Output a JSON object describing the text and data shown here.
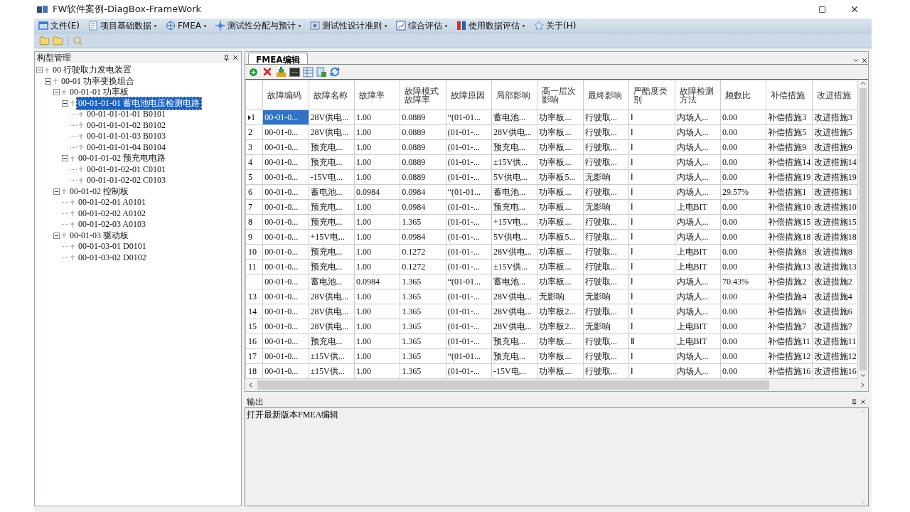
{
  "window": {
    "title": "FW软件案例-DiagBox-FrameWork"
  },
  "menu": [
    {
      "label": "文件(E)",
      "dropdown": false
    },
    {
      "label": "项目基础数据",
      "dropdown": true
    },
    {
      "label": "FMEA",
      "dropdown": true
    },
    {
      "label": "测试性分配与预计",
      "dropdown": true
    },
    {
      "label": "测试性设计准则",
      "dropdown": true
    },
    {
      "label": "综合评估",
      "dropdown": true
    },
    {
      "label": "使用数据评估",
      "dropdown": true
    },
    {
      "label": "关于(H)",
      "dropdown": false
    }
  ],
  "tree_panel": {
    "title": "构型管理",
    "nodes": [
      {
        "label": "00 行驶取力发电装置",
        "selected": false,
        "expanded": true,
        "children": [
          {
            "label": "00-01 功率变换组合",
            "selected": false,
            "expanded": true,
            "children": [
              {
                "label": "00-01-01 功率板",
                "selected": false,
                "expanded": true,
                "children": [
                  {
                    "label": "00-01-01-01 蓄电池电压检测电路",
                    "selected": true,
                    "expanded": true,
                    "children": [
                      {
                        "label": "00-01-01-01-01 B0101",
                        "selected": false
                      },
                      {
                        "label": "00-01-01-01-02 B0102",
                        "selected": false
                      },
                      {
                        "label": "00-01-01-01-03 B0103",
                        "selected": false
                      },
                      {
                        "label": "00-01-01-01-04 B0104",
                        "selected": false
                      }
                    ]
                  },
                  {
                    "label": "00-01-01-02 预充电电路",
                    "selected": false,
                    "expanded": true,
                    "children": [
                      {
                        "label": "00-01-01-02-01 C0101",
                        "selected": false
                      },
                      {
                        "label": "00-01-01-02-02 C0103",
                        "selected": false
                      }
                    ]
                  }
                ]
              },
              {
                "label": "00-01-02 控制板",
                "selected": false,
                "expanded": true,
                "children": [
                  {
                    "label": "00-01-02-01 A0101",
                    "selected": false
                  },
                  {
                    "label": "00-01-02-02 A0102",
                    "selected": false
                  },
                  {
                    "label": "00-01-02-03 A0103",
                    "selected": false
                  }
                ]
              },
              {
                "label": "00-01-03 驱动板",
                "selected": false,
                "expanded": true,
                "children": [
                  {
                    "label": "00-01-03-01 D0101",
                    "selected": false
                  },
                  {
                    "label": "00-01-03-02 D0102",
                    "selected": false
                  }
                ]
              }
            ]
          }
        ]
      }
    ]
  },
  "editor": {
    "tabs": [
      {
        "label": "FMEA编辑",
        "selected": true
      }
    ],
    "table": {
      "columns": [
        "故障编码",
        "故障名称",
        "故障率",
        "故障模式故障率",
        "故障原因",
        "局部影响",
        "高一层次影响",
        "最终影响",
        "严酷度类别",
        "故障检测方法",
        "频数比",
        "补偿措施",
        "改进措施"
      ],
      "rows": [
        {
          "row_header": "1",
          "current": true,
          "selected": true,
          "cells": [
            "00-01-0...",
            "28V供电...",
            "1.00",
            "0.0889",
            "“(01-01...",
            "蓄电池...",
            "功率板...",
            "行驶取...",
            "Ⅰ",
            "内场人...",
            "0.00",
            "补偿措施3",
            "改进措施3"
          ]
        },
        {
          "row_header": "2",
          "current": false,
          "selected": false,
          "cells": [
            "00-01-0...",
            "28V供电...",
            "1.00",
            "0.0889",
            "(01-01-...",
            "28V供电...",
            "功率板...",
            "行驶取...",
            "Ⅰ",
            "内场人...",
            "0.00",
            "补偿措施5",
            "改进措施5"
          ]
        },
        {
          "row_header": "3",
          "current": false,
          "selected": false,
          "cells": [
            "00-01-0...",
            "预充电...",
            "1.00",
            "0.0889",
            "(01-01-...",
            "预充电...",
            "功率板...",
            "行驶取...",
            "Ⅰ",
            "内场人...",
            "0.00",
            "补偿措施9",
            "改进措施9"
          ]
        },
        {
          "row_header": "4",
          "current": false,
          "selected": false,
          "cells": [
            "00-01-0...",
            "预充电...",
            "1.00",
            "0.0889",
            "(01-01-...",
            "±15V供...",
            "功率板...",
            "行驶取...",
            "Ⅰ",
            "内场人...",
            "0.00",
            "补偿措施14",
            "改进措施14"
          ]
        },
        {
          "row_header": "5",
          "current": false,
          "selected": false,
          "cells": [
            "00-01-0...",
            "-15V电...",
            "1.00",
            "0.0889",
            "(01-01-...",
            "5V供电...",
            "功率板5...",
            "无影响",
            "Ⅰ",
            "内场人...",
            "0.00",
            "补偿措施19",
            "改进措施19"
          ]
        },
        {
          "row_header": "6",
          "current": false,
          "selected": false,
          "cells": [
            "00-01-0...",
            "蓄电池...",
            "0.0984",
            "0.0984",
            "“(01-01...",
            "蓄电池...",
            "功率板...",
            "行驶取...",
            "Ⅰ",
            "内场人...",
            "29.57%",
            "补偿措施1",
            "改进措施1"
          ]
        },
        {
          "row_header": "7",
          "current": false,
          "selected": false,
          "cells": [
            "00-01-0...",
            "预充电...",
            "1.00",
            "0.0984",
            "(01-01-...",
            "预充电...",
            "功率板...",
            "无影响",
            "Ⅰ",
            "上电BIT",
            "0.00",
            "补偿措施10",
            "改进措施10"
          ]
        },
        {
          "row_header": "8",
          "current": false,
          "selected": false,
          "cells": [
            "00-01-0...",
            "预充电...",
            "1.00",
            "1.365",
            "(01-01-...",
            "+15V电...",
            "功率板...",
            "行驶取...",
            "Ⅰ",
            "内场人...",
            "0.00",
            "补偿措施15",
            "改进措施15"
          ]
        },
        {
          "row_header": "9",
          "current": false,
          "selected": false,
          "cells": [
            "00-01-0...",
            "+15V电...",
            "1.00",
            "0.0984",
            "(01-01-...",
            "5V供电...",
            "功率板5...",
            "行驶取...",
            "Ⅰ",
            "内场人...",
            "0.00",
            "补偿措施18",
            "改进措施18"
          ]
        },
        {
          "row_header": "10",
          "current": false,
          "selected": false,
          "cells": [
            "00-01-0...",
            "预充电...",
            "1.00",
            "0.1272",
            "(01-01-...",
            "28V供电...",
            "功率板...",
            "行驶取...",
            "Ⅰ",
            "上电BIT",
            "0.00",
            "补偿措施8",
            "改进措施8"
          ]
        },
        {
          "row_header": "11",
          "current": false,
          "selected": false,
          "cells": [
            "00-01-0...",
            "预充电...",
            "1.00",
            "0.1272",
            "(01-01-...",
            "±15V供...",
            "功率板...",
            "行驶取...",
            "Ⅰ",
            "上电BIT",
            "0.00",
            "补偿措施13",
            "改进措施13"
          ]
        },
        {
          "current": false,
          "selected": false,
          "cells": [
            "00-01-0...",
            "蓄电池...",
            "0.0984",
            "1.365",
            "“(01-01...",
            "蓄电池...",
            "功率板...",
            "行驶取...",
            "Ⅰ",
            "内场人...",
            "70.43%",
            "补偿措施2",
            "改进措施2"
          ]
        },
        {
          "row_header": "13",
          "current": false,
          "selected": false,
          "cells": [
            "00-01-0...",
            "28V供电...",
            "1.00",
            "1.365",
            "(01-01-...",
            "28V供电...",
            "无影响",
            "无影响",
            "Ⅰ",
            "内场人...",
            "0.00",
            "补偿措施4",
            "改进措施4"
          ]
        },
        {
          "row_header": "14",
          "current": false,
          "selected": false,
          "cells": [
            "00-01-0...",
            "28V供电...",
            "1.00",
            "1.365",
            "(01-01-...",
            "28V供电...",
            "功率板2...",
            "行驶取...",
            "Ⅰ",
            "内场人...",
            "0.00",
            "补偿措施6",
            "改进措施6"
          ]
        },
        {
          "row_header": "15",
          "current": false,
          "selected": false,
          "cells": [
            "00-01-0...",
            "28V供电...",
            "1.00",
            "1.365",
            "(01-01-...",
            "28V供电...",
            "功率板2...",
            "无影响",
            "Ⅰ",
            "上电BIT",
            "0.00",
            "补偿措施7",
            "改进措施7"
          ]
        },
        {
          "row_header": "16",
          "current": false,
          "selected": false,
          "cells": [
            "00-01-0...",
            "预充电...",
            "1.00",
            "1.365",
            "(01-01-...",
            "预充电...",
            "功率板...",
            "行驶取...",
            "Ⅱ",
            "上电BIT",
            "0.00",
            "补偿措施11",
            "改进措施11"
          ]
        },
        {
          "row_header": "17",
          "current": false,
          "selected": false,
          "cells": [
            "00-01-0...",
            "±15V供...",
            "1.00",
            "1.365",
            "“(01-01...",
            "预充电...",
            "功率板...",
            "行驶取...",
            "Ⅰ",
            "内场人...",
            "0.00",
            "补偿措施12",
            "改进措施12"
          ]
        },
        {
          "row_header": "18",
          "current": false,
          "selected": false,
          "cells": [
            "00-01-0...",
            "±15V供...",
            "1.00",
            "1.365",
            "(01-01-...",
            "-15V电...",
            "功率板...",
            "行驶取...",
            "Ⅰ",
            "内场人...",
            "0.00",
            "补偿措施16",
            "改进措施16"
          ]
        }
      ]
    }
  },
  "output": {
    "title": "输出",
    "lines": [
      "打开最新版本FMEA编辑"
    ]
  }
}
